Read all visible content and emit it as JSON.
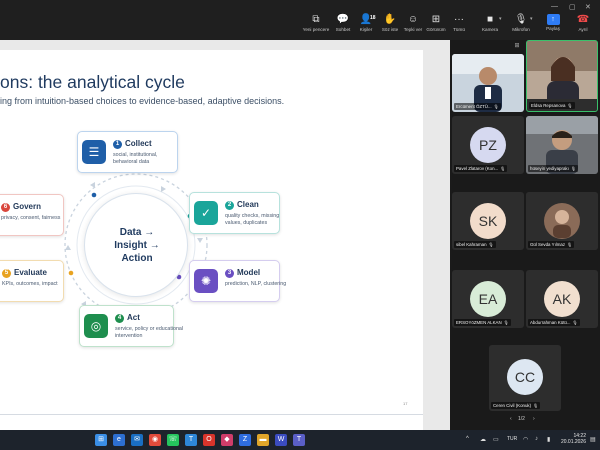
{
  "toolbar": {
    "buttons": [
      {
        "label": "Yeni pencere",
        "icon": "new-window-icon"
      },
      {
        "label": "Sohbet",
        "icon": "chat-icon"
      },
      {
        "label": "Kişiler",
        "icon": "people-icon",
        "count": "18"
      },
      {
        "label": "Söz iste",
        "icon": "raise-hand-icon"
      },
      {
        "label": "Tepki ver",
        "icon": "react-icon"
      },
      {
        "label": "Görünüm",
        "icon": "view-icon"
      },
      {
        "label": "Tümü",
        "icon": "more-icon"
      },
      {
        "label": "Kamera",
        "icon": "camera-icon"
      },
      {
        "label": "Mikrofon",
        "icon": "microphone-icon"
      },
      {
        "label": "Paylaş",
        "icon": "share-icon"
      },
      {
        "label": "Ayrıl",
        "icon": "leave-phone-icon"
      }
    ]
  },
  "slide": {
    "title": "ons: the analytical cycle",
    "subtitle": "ing from intuition-based choices to evidence-based, adaptive decisions.",
    "center_text": [
      "Data →",
      "Insight →",
      "Action"
    ],
    "page_number": "17",
    "nodes": [
      {
        "num": "1",
        "title": "Collect",
        "desc": "social, institutional, behavioral data",
        "color": "#1f5fa8"
      },
      {
        "num": "2",
        "title": "Clean",
        "desc": "quality checks, missing values, duplicates",
        "color": "#1aa59a"
      },
      {
        "num": "3",
        "title": "Model",
        "desc": "prediction, NLP, clustering",
        "color": "#6a4fc2"
      },
      {
        "num": "4",
        "title": "Act",
        "desc": "service, policy or educational intervention",
        "color": "#1e8e4e"
      },
      {
        "num": "5",
        "title": "Evaluate",
        "desc": "KPIs, outcomes, impact",
        "color": "#e8a321"
      },
      {
        "num": "6",
        "title": "Govern",
        "desc": "privacy, consent, fairness",
        "color": "#d9463c"
      }
    ]
  },
  "participants": {
    "tiles": [
      {
        "name": "Ercüment ÖZTÜ...",
        "initials": "",
        "type": "video"
      },
      {
        "name": "Eldsa Repsanova",
        "initials": "",
        "type": "video"
      },
      {
        "name": "Pavel Zlatarov (Kon...",
        "initials": "PZ",
        "type": "avatar"
      },
      {
        "name": "hüseyin yediyaprakı",
        "initials": "",
        "type": "video"
      },
      {
        "name": "sibel Kahraman",
        "initials": "SK",
        "type": "avatar"
      },
      {
        "name": "Gül Sevda Yılmaz",
        "initials": "",
        "type": "photo"
      },
      {
        "name": "ERSOYöZMEN ALKAN",
        "initials": "EA",
        "type": "avatar"
      },
      {
        "name": "Abdurrahman Kütü...",
        "initials": "AK",
        "type": "avatar"
      },
      {
        "name": "Ceren Civil (Konuk)",
        "initials": "CC",
        "type": "avatar"
      }
    ],
    "page_indicator": "1/2"
  },
  "taskbar": {
    "lang": "TUR",
    "time": "14:22",
    "date": "20.01.2026"
  }
}
